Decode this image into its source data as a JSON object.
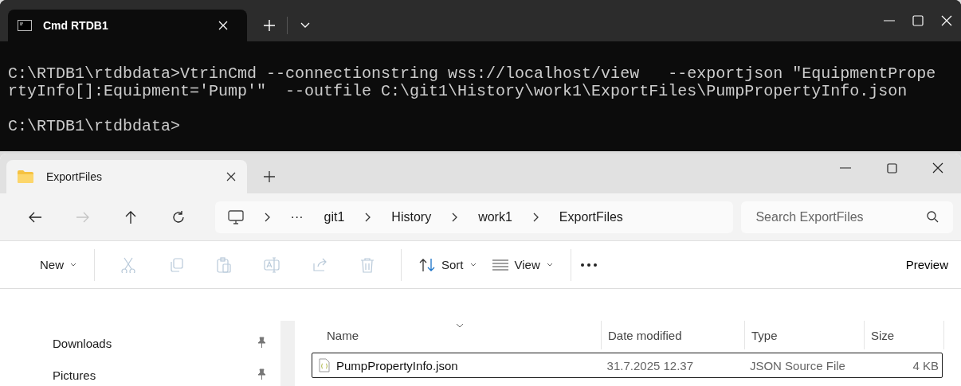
{
  "terminal": {
    "tab_title": "Cmd RTDB1",
    "lines": [
      "C:\\RTDB1\\rtdbdata>VtrinCmd --connectionstring wss://localhost/view   --exportjson \"EquipmentPrope",
      "rtyInfo[]:Equipment='Pump'\"  --outfile C:\\git1\\History\\work1\\ExportFiles\\PumpPropertyInfo.json"
    ],
    "prompt": "C:\\RTDB1\\rtdbdata>"
  },
  "explorer": {
    "tab_title": "ExportFiles",
    "nav_buttons": [
      {
        "kind": "back",
        "disabled": false
      },
      {
        "kind": "forward",
        "disabled": true
      },
      {
        "kind": "up",
        "disabled": false
      },
      {
        "kind": "refresh",
        "disabled": false
      }
    ],
    "breadcrumb": {
      "overflow": "···",
      "segments": [
        "git1",
        "History",
        "work1",
        "ExportFiles"
      ]
    },
    "search": {
      "placeholder": "Search ExportFiles"
    },
    "toolbar": [
      {
        "kind": "new",
        "label": "New",
        "disabled": false
      },
      {
        "kind": "cut",
        "disabled": true
      },
      {
        "kind": "copy",
        "disabled": true
      },
      {
        "kind": "paste",
        "disabled": true
      },
      {
        "kind": "rename",
        "disabled": true
      },
      {
        "kind": "share",
        "disabled": true
      },
      {
        "kind": "delete",
        "disabled": true
      },
      {
        "kind": "sort",
        "label": "Sort",
        "disabled": false
      },
      {
        "kind": "view",
        "label": "View",
        "disabled": false
      },
      {
        "kind": "more",
        "disabled": false
      }
    ],
    "preview": "Preview",
    "sidebar": {
      "items": [
        {
          "label": "Downloads",
          "pinned": true
        },
        {
          "label": "Pictures",
          "pinned": true
        }
      ]
    },
    "table": {
      "columns": [
        "Name",
        "Date modified",
        "Type",
        "Size"
      ],
      "rows": [
        {
          "name": "PumpPropertyInfo.json",
          "date": "31.7.2025 12.37",
          "type": "JSON Source File",
          "size": "4 KB",
          "selected": true
        }
      ]
    }
  }
}
